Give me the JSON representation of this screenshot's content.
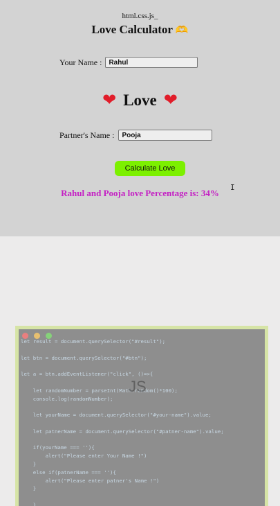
{
  "app": {
    "brand": "html.css.js_",
    "title": "Love Calculator",
    "title_emoji": "🫶",
    "name_label": "Your Name :",
    "name_value": "Rahul",
    "love_heart": "❤",
    "love_word": "Love",
    "partner_label": "Partner's Name :",
    "partner_value": "Pooja",
    "button_label": "Calculate Love",
    "result_text": "Rahul and Pooja love Percentage is: 34%",
    "cursor_glyph": "I"
  },
  "code_panel": {
    "watermark": "JS",
    "dot_colors": [
      "#e97f7f",
      "#e8c070",
      "#86d27a"
    ],
    "code": "let result = document.querySelector(\"#result\");\n\nlet btn = document.querySelector(\"#btn\");\n\nlet a = btn.addEventListener(\"click\", ()=>{\n\n    let randomNumber = parseInt(Math.random()*100);\n    console.log(randomNumber);\n\n    let yourName = document.querySelector(\"#your-name\").value;\n\n    let patnerName = document.querySelector(\"#patner-name\").value;\n\n    if(yourName === ''){\n        alert(\"Please enter Your Name !\")\n    }\n    else if(patnerName === ''){\n        alert(\"Please enter patner's Name !\")\n    }\n\n    }"
  },
  "colors": {
    "page_bg": "#d3d3d3",
    "button_bg": "#7cf000",
    "result_color": "#c41fc4",
    "heart_color": "#e11d2a"
  }
}
